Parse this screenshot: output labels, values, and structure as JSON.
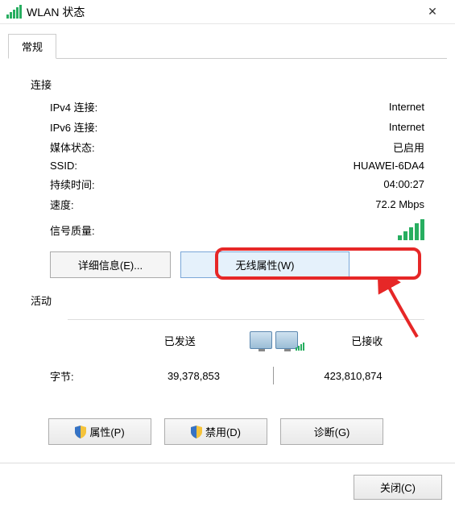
{
  "window": {
    "title": "WLAN 状态"
  },
  "tabs": {
    "general": "常规"
  },
  "connection": {
    "section_label": "连接",
    "ipv4_label": "IPv4 连接:",
    "ipv4_value": "Internet",
    "ipv6_label": "IPv6 连接:",
    "ipv6_value": "Internet",
    "media_label": "媒体状态:",
    "media_value": "已启用",
    "ssid_label": "SSID:",
    "ssid_value": "HUAWEI-6DA4",
    "duration_label": "持续时间:",
    "duration_value": "04:00:27",
    "speed_label": "速度:",
    "speed_value": "72.2 Mbps",
    "signal_label": "信号质量:"
  },
  "buttons": {
    "details": "详细信息(E)...",
    "wireless_props": "无线属性(W)",
    "properties": "属性(P)",
    "disable": "禁用(D)",
    "diagnose": "诊断(G)",
    "close": "关闭(C)"
  },
  "activity": {
    "section_label": "活动",
    "sent_label": "已发送",
    "received_label": "已接收",
    "bytes_label": "字节:",
    "bytes_sent": "39,378,853",
    "bytes_received": "423,810,874"
  }
}
